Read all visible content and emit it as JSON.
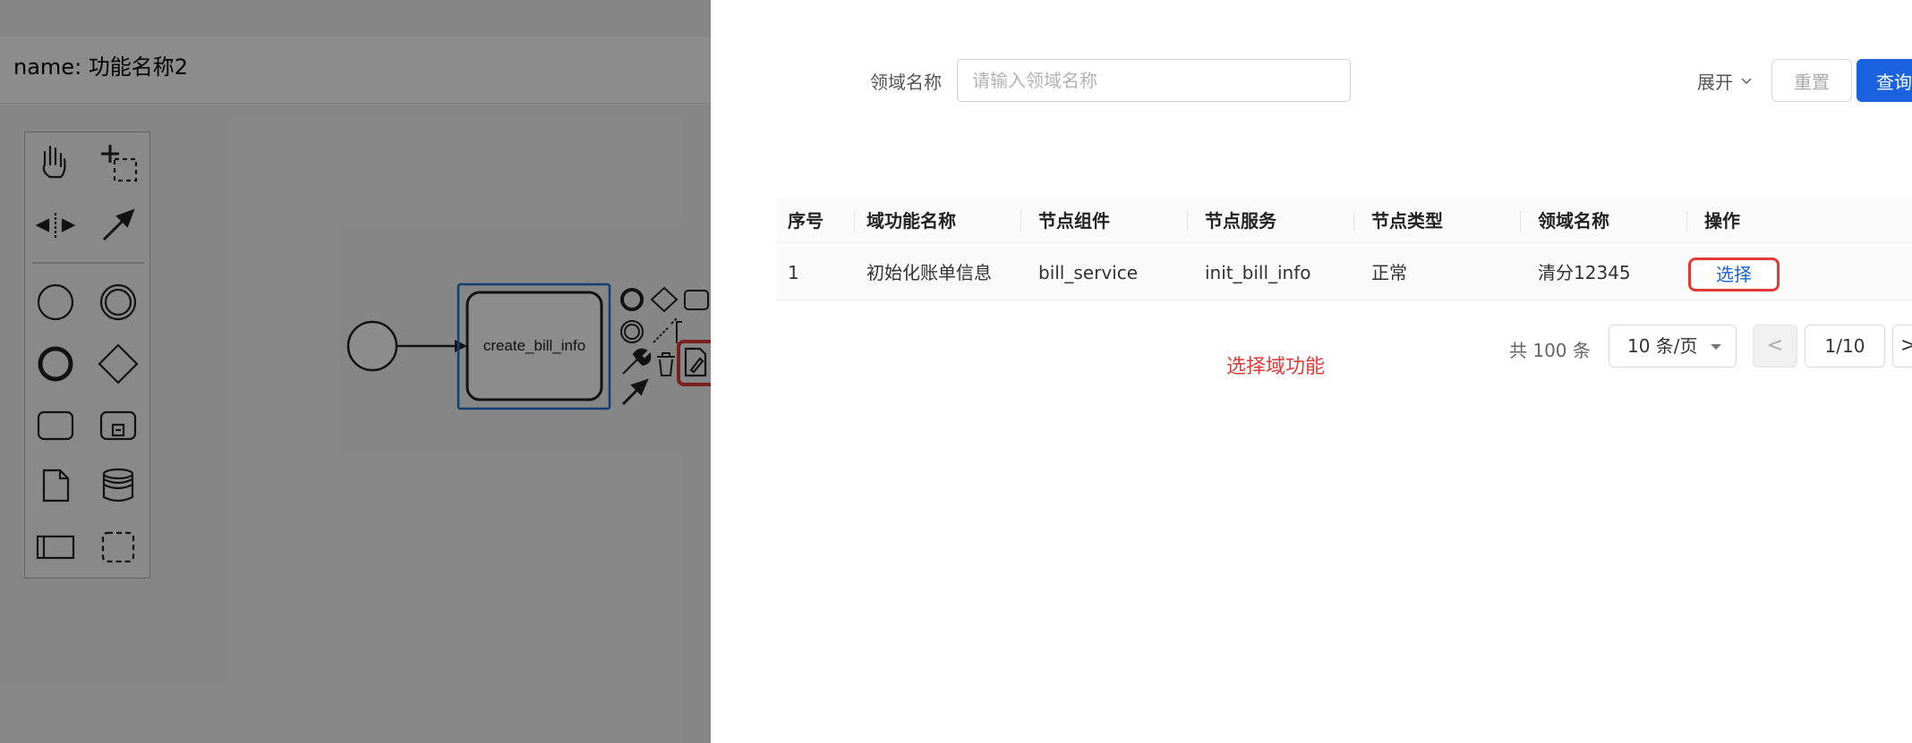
{
  "editor": {
    "name_label": "name: 功能名称2",
    "task_label": "create_bill_info"
  },
  "palette": {
    "tools": [
      "hand-tool",
      "lasso-tool",
      "space-tool",
      "global-connect-tool"
    ],
    "shapes": [
      "start-event",
      "intermediate-event",
      "end-event",
      "gateway",
      "task",
      "subprocess",
      "data-object",
      "data-store",
      "participant",
      "group"
    ]
  },
  "filter": {
    "label": "领域名称",
    "placeholder": "请输入领域名称",
    "expand_label": "展开",
    "reset_label": "重置",
    "query_label": "查询"
  },
  "table": {
    "columns": [
      "序号",
      "域功能名称",
      "节点组件",
      "节点服务",
      "节点类型",
      "领域名称",
      "操作"
    ],
    "rows": [
      {
        "index": "1",
        "func_name": "初始化账单信息",
        "component": "bill_service",
        "service": "init_bill_info",
        "type": "正常",
        "domain": "清分12345",
        "action": "选择"
      }
    ]
  },
  "annotation": "选择域功能",
  "pagination": {
    "total": "共 100 条",
    "page_size": "10 条/页",
    "current": "1/10",
    "prev": "<",
    "next": ">"
  },
  "colors": {
    "primary": "#1a62e0",
    "highlight": "#e03a3a"
  }
}
